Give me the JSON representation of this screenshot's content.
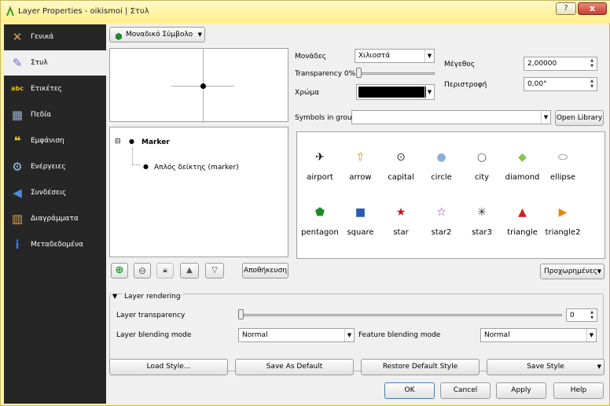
{
  "window": {
    "title": "Layer Properties - oikismoi | Στυλ",
    "help": "?",
    "close": "x"
  },
  "sidebar": {
    "items": [
      {
        "label": "Γενικά",
        "icon": "tools-icon",
        "glyph": "✕",
        "color": "#d8a060"
      },
      {
        "label": "Στυλ",
        "icon": "brush-icon",
        "glyph": "✎",
        "color": "#6a6ad0"
      },
      {
        "label": "Ετικέτες",
        "icon": "abc-label-icon",
        "glyph": "abc",
        "color": "#e8c020"
      },
      {
        "label": "Πεδία",
        "icon": "table-icon",
        "glyph": "▦",
        "color": "#9ab0d0"
      },
      {
        "label": "Εμφάνιση",
        "icon": "speech-bubble-icon",
        "glyph": "❝",
        "color": "#f0d040"
      },
      {
        "label": "Ενέργειες",
        "icon": "gear-icon",
        "glyph": "⚙",
        "color": "#9ac0f0"
      },
      {
        "label": "Συνδέσεις",
        "icon": "join-icon",
        "glyph": "◀",
        "color": "#4a8ad8"
      },
      {
        "label": "Διαγράμματα",
        "icon": "chart-icon",
        "glyph": "▥",
        "color": "#e0a050"
      },
      {
        "label": "Μεταδεδομένα",
        "icon": "info-icon",
        "glyph": "i",
        "color": "#3a7ad8"
      }
    ]
  },
  "renderer": {
    "selected": "Μοναδικό Σύμβολο"
  },
  "tree": {
    "root": "Marker",
    "child": "Απλός δείκτης (marker)"
  },
  "layer_buttons": {
    "save": "Αποθήκευση"
  },
  "props": {
    "units_label": "Μονάδες",
    "units_value": "Χιλιοστά",
    "transparency_label": "Transparency 0%",
    "color_label": "Χρώμα",
    "color_value": "#000000",
    "size_label": "Μέγεθος",
    "size_value": "2,00000",
    "rotation_label": "Περιστροφή",
    "rotation_value": "0,00°"
  },
  "symbols": {
    "group_label": "Symbols in group",
    "group_value": "",
    "open_library": "Open Library",
    "items": [
      {
        "name": "airport",
        "glyph": "✈",
        "color": "#000000"
      },
      {
        "name": "arrow",
        "glyph": "⇧",
        "color": "#d08a20"
      },
      {
        "name": "capital",
        "glyph": "⊙",
        "color": "#333333"
      },
      {
        "name": "circle",
        "glyph": "●",
        "color": "#8ab0d8"
      },
      {
        "name": "city",
        "glyph": "○",
        "color": "#555555"
      },
      {
        "name": "diamond",
        "glyph": "◆",
        "color": "#80c850"
      },
      {
        "name": "ellipse",
        "glyph": "⬭",
        "color": "#666666"
      },
      {
        "name": "pentagon",
        "glyph": "⬟",
        "color": "#1a8a2a"
      },
      {
        "name": "square",
        "glyph": "■",
        "color": "#2a5ab0"
      },
      {
        "name": "star",
        "glyph": "★",
        "color": "#c01818"
      },
      {
        "name": "star2",
        "glyph": "☆",
        "color": "#7a2ab0"
      },
      {
        "name": "star3",
        "glyph": "✳",
        "color": "#333333"
      },
      {
        "name": "triangle",
        "glyph": "▲",
        "color": "#d02020"
      },
      {
        "name": "triangle2",
        "glyph": "▶",
        "color": "#e08a10"
      }
    ]
  },
  "advanced": "Προχωρημένες",
  "layer_rendering": {
    "title": "Layer rendering",
    "transparency_label": "Layer transparency",
    "transparency_value": "0",
    "blending_label": "Layer blending mode",
    "blending_value": "Normal",
    "feature_blending_label": "Feature blending mode",
    "feature_blending_value": "Normal"
  },
  "style_buttons": {
    "load": "Load Style...",
    "save_default": "Save As Default",
    "restore": "Restore Default Style",
    "save": "Save Style"
  },
  "dialog": {
    "ok": "OK",
    "cancel": "Cancel",
    "apply": "Apply",
    "help": "Help"
  }
}
